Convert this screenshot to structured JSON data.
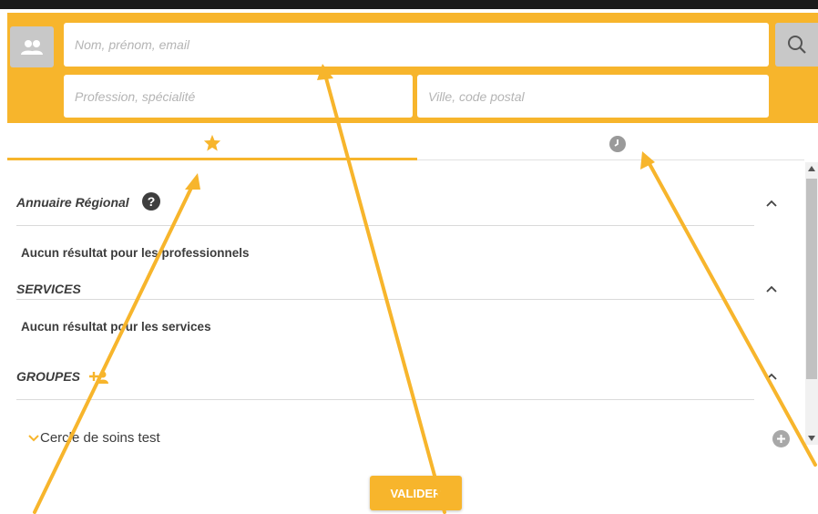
{
  "search": {
    "name_placeholder": "Nom, prénom, email",
    "profession_placeholder": "Profession, spécialité",
    "city_placeholder": "Ville, code postal"
  },
  "tabs": [
    {
      "icon": "star-icon",
      "active": true
    },
    {
      "icon": "clock-icon",
      "active": false
    }
  ],
  "sections": {
    "regional": {
      "title": "Annuaire Régional",
      "help": "?",
      "empty_message": "Aucun résultat pour les professionnels"
    },
    "services": {
      "title": "SERVICES",
      "empty_message": "Aucun résultat pour les services"
    },
    "groups": {
      "title": "GROUPES",
      "items": [
        "Cercle de soins test"
      ]
    }
  },
  "footer": {
    "validate_label": "VALIDER"
  },
  "colors": {
    "accent": "#f7b52c",
    "button_gray": "#c8c8c8",
    "text": "#3c3c3c",
    "placeholder": "#b4b4b4"
  }
}
